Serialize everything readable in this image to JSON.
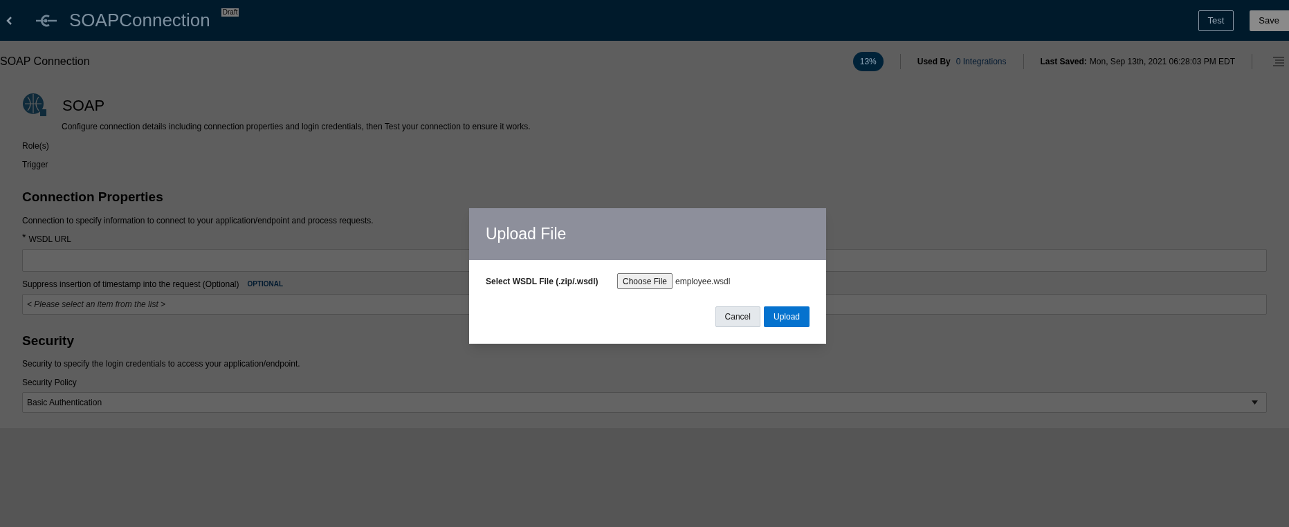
{
  "header": {
    "title": "SOAPConnection",
    "badge": "Draft",
    "buttons": [
      {
        "label": "Test",
        "kind": "outline"
      },
      {
        "label": "Save",
        "kind": "filled"
      }
    ]
  },
  "subheader": {
    "title": "SOAP Connection",
    "progress": "13%",
    "used_by_label": "Used By",
    "used_by_value": "0 Integrations",
    "last_saved_label": "Last Saved:",
    "last_saved_value": "Mon, Sep 13th, 2021 06:28:03 PM EDT"
  },
  "page": {
    "heading": "SOAP",
    "description": "Configure connection details including connection properties and login credentials, then Test your connection to ensure it works.",
    "roles_label": "Role(s)",
    "role": "Trigger",
    "sections": [
      {
        "title": "Connection Properties",
        "description": "Connection to specify information to connect to your application/endpoint and process requests.",
        "fields": [
          {
            "kind": "text",
            "label": "WSDL URL",
            "mark": "*"
          },
          {
            "kind": "list",
            "label": "Suppress insertion of timestamp into the request (Optional)",
            "tag": "OPTIONAL",
            "placeholder": "< Please select an item from the list >"
          }
        ]
      },
      {
        "title": "Security",
        "description": "Security to specify the login credentials to access your application/endpoint.",
        "fields": [
          {
            "kind": "dropdown",
            "label": "Security Policy",
            "value": "Basic Authentication"
          }
        ]
      }
    ]
  },
  "dialog": {
    "title": "Upload File",
    "field_label": "Select WSDL File (.zip/.wsdl)",
    "file_button": "Choose File",
    "file_name": "employee.wsdl",
    "buttons": [
      {
        "label": "Cancel",
        "kind": "secondary"
      },
      {
        "label": "Upload",
        "kind": "primary"
      }
    ]
  }
}
